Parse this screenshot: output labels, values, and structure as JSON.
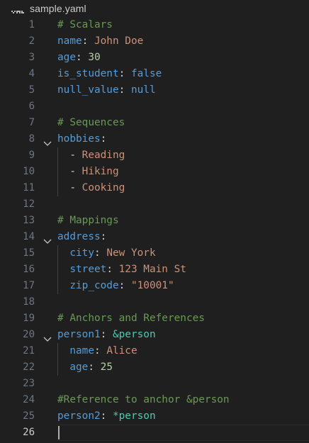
{
  "tab": {
    "filename": "sample.yaml",
    "icon": "yaml-file-icon"
  },
  "colors": {
    "background": "#1f1f1f",
    "comment": "#6a9955",
    "key": "#569cd6",
    "string": "#ce9178",
    "number": "#b5cea8",
    "anchor": "#4ec9b0",
    "line_number": "#6e7681",
    "active_line_number": "#cccccc"
  },
  "editor": {
    "active_line": 26,
    "lines": [
      {
        "num": "1",
        "comment": "# Scalars"
      },
      {
        "num": "2",
        "key": "name",
        "colon": ": ",
        "str": "John Doe"
      },
      {
        "num": "3",
        "key": "age",
        "colon": ": ",
        "number": "30"
      },
      {
        "num": "4",
        "key": "is_student",
        "colon": ": ",
        "bool": "false"
      },
      {
        "num": "5",
        "key": "null_value",
        "colon": ": ",
        "bool": "null"
      },
      {
        "num": "6"
      },
      {
        "num": "7",
        "comment": "# Sequences"
      },
      {
        "num": "8",
        "key": "hobbies",
        "colon": ":",
        "fold": true
      },
      {
        "num": "9",
        "dash": "  - ",
        "str": "Reading"
      },
      {
        "num": "10",
        "dash": "  - ",
        "str": "Hiking"
      },
      {
        "num": "11",
        "dash": "  - ",
        "str": "Cooking"
      },
      {
        "num": "12"
      },
      {
        "num": "13",
        "comment": "# Mappings"
      },
      {
        "num": "14",
        "key": "address",
        "colon": ":",
        "fold": true
      },
      {
        "num": "15",
        "indent": "  ",
        "key": "city",
        "colon": ": ",
        "str": "New York"
      },
      {
        "num": "16",
        "indent": "  ",
        "key": "street",
        "colon": ": ",
        "str": "123 Main St"
      },
      {
        "num": "17",
        "indent": "  ",
        "key": "zip_code",
        "colon": ": ",
        "str": "\"10001\""
      },
      {
        "num": "18"
      },
      {
        "num": "19",
        "comment": "# Anchors and References"
      },
      {
        "num": "20",
        "key": "person1",
        "colon": ": ",
        "anchor": "&person",
        "fold": true
      },
      {
        "num": "21",
        "indent": "  ",
        "key": "name",
        "colon": ": ",
        "str": "Alice"
      },
      {
        "num": "22",
        "indent": "  ",
        "key": "age",
        "colon": ": ",
        "number": "25"
      },
      {
        "num": "23"
      },
      {
        "num": "24",
        "comment": "#Reference to anchor &person"
      },
      {
        "num": "25",
        "key": "person2",
        "colon": ": ",
        "anchor": "*person"
      },
      {
        "num": "26"
      }
    ]
  }
}
